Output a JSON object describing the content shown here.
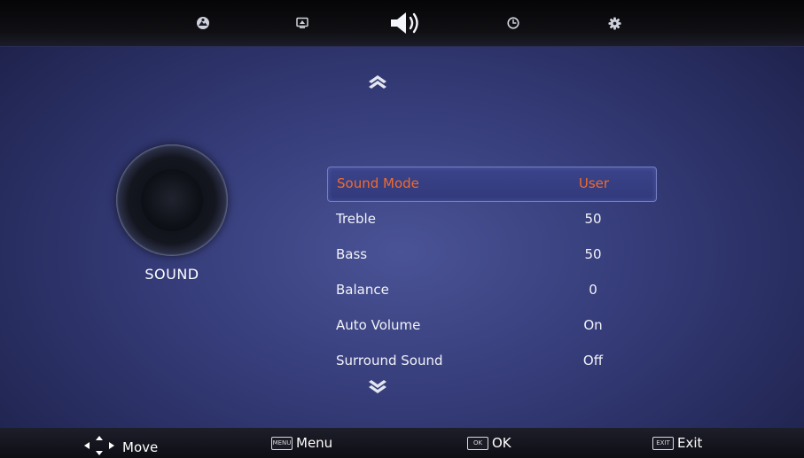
{
  "top_tabs": [
    {
      "icon": "picture-icon",
      "selected": false
    },
    {
      "icon": "source-icon",
      "selected": false
    },
    {
      "icon": "speaker-icon",
      "selected": true
    },
    {
      "icon": "clock-icon",
      "selected": false
    },
    {
      "icon": "gear-icon",
      "selected": false
    }
  ],
  "page": {
    "label": "SOUND"
  },
  "menu": {
    "items": [
      {
        "label": "Sound Mode",
        "value": "User"
      },
      {
        "label": "Treble",
        "value": "50"
      },
      {
        "label": "Bass",
        "value": "50"
      },
      {
        "label": "Balance",
        "value": "0"
      },
      {
        "label": "Auto Volume",
        "value": "On"
      },
      {
        "label": "Surround Sound",
        "value": "Off"
      }
    ]
  },
  "footer": {
    "move": {
      "label": "Move"
    },
    "menu": {
      "key": "MENU",
      "label": "Menu"
    },
    "ok": {
      "key": "OK",
      "label": "OK"
    },
    "exit": {
      "key": "EXIT",
      "label": "Exit"
    }
  },
  "colors": {
    "accent": "#f06a2e",
    "background": "#363d7a",
    "text": "#f2f3f8"
  }
}
